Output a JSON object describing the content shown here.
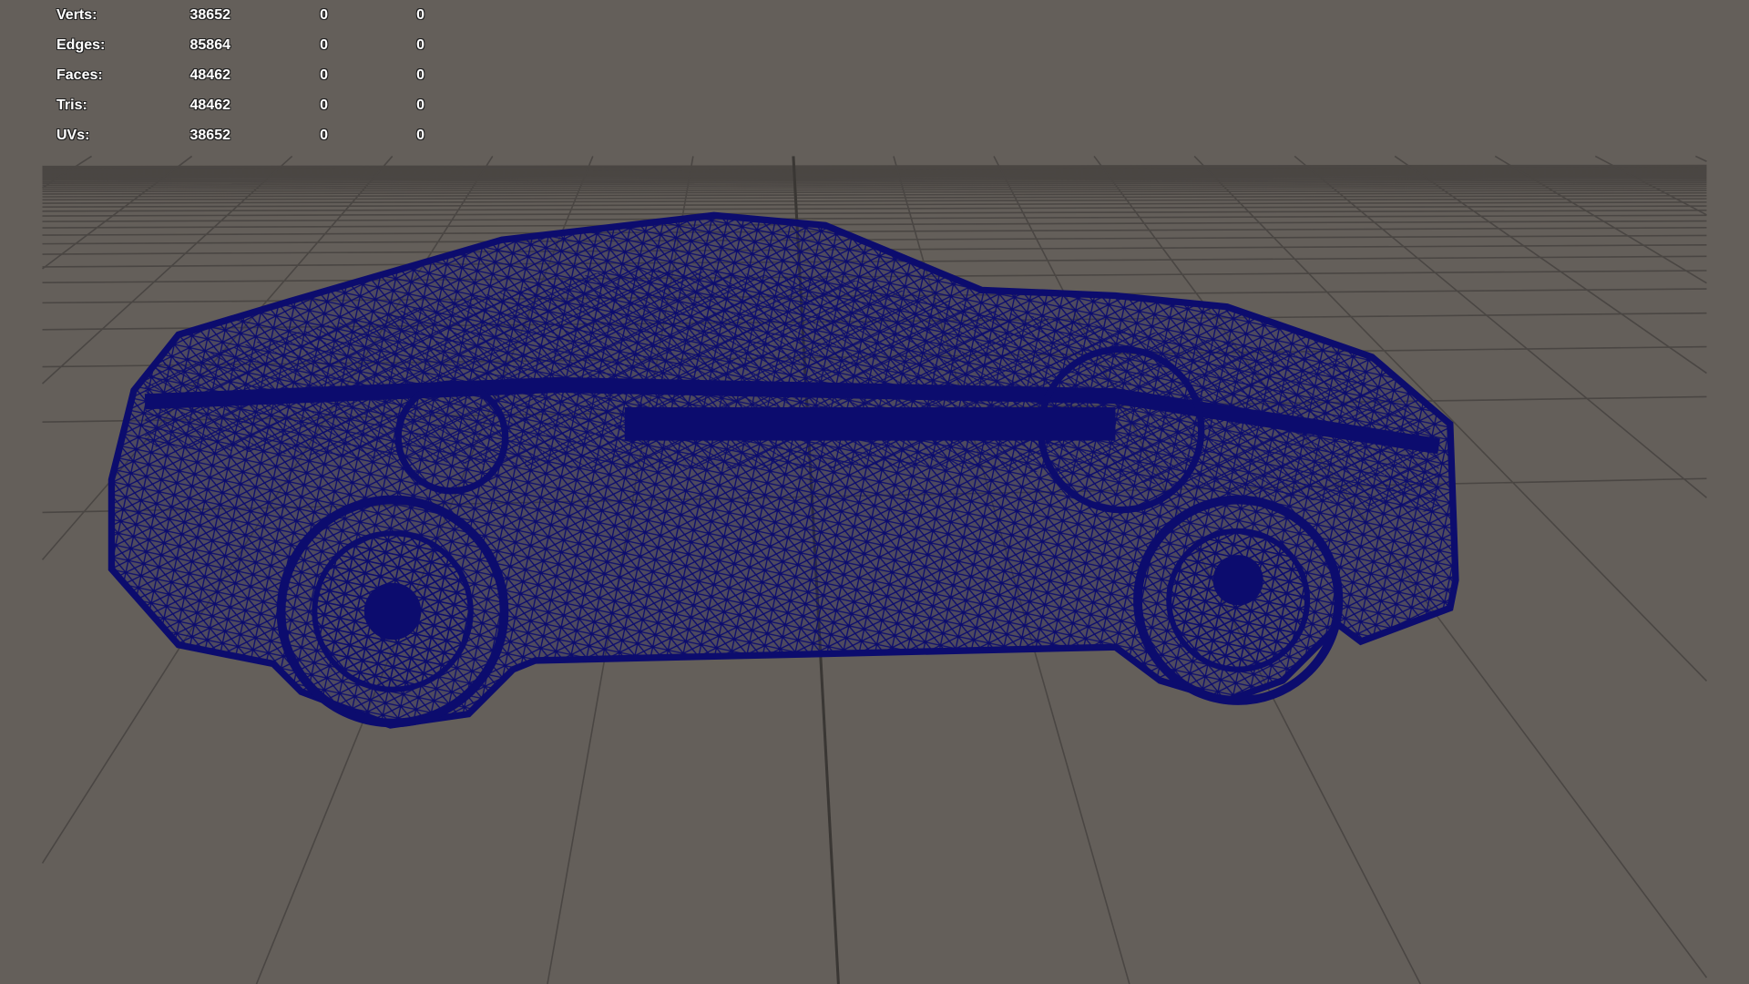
{
  "stats": [
    {
      "label": "Verts:",
      "value": "38652",
      "col2": "0",
      "col3": "0"
    },
    {
      "label": "Edges:",
      "value": "85864",
      "col2": "0",
      "col3": "0"
    },
    {
      "label": "Faces:",
      "value": "48462",
      "col2": "0",
      "col3": "0"
    },
    {
      "label": "Tris:",
      "value": "48462",
      "col2": "0",
      "col3": "0"
    },
    {
      "label": "UVs:",
      "value": "38652",
      "col2": "0",
      "col3": "0"
    }
  ],
  "colors": {
    "background": "#645f5a",
    "grid": "#4a4643",
    "grid_axis": "#3a3734",
    "wireframe": "#0c0c6e"
  }
}
